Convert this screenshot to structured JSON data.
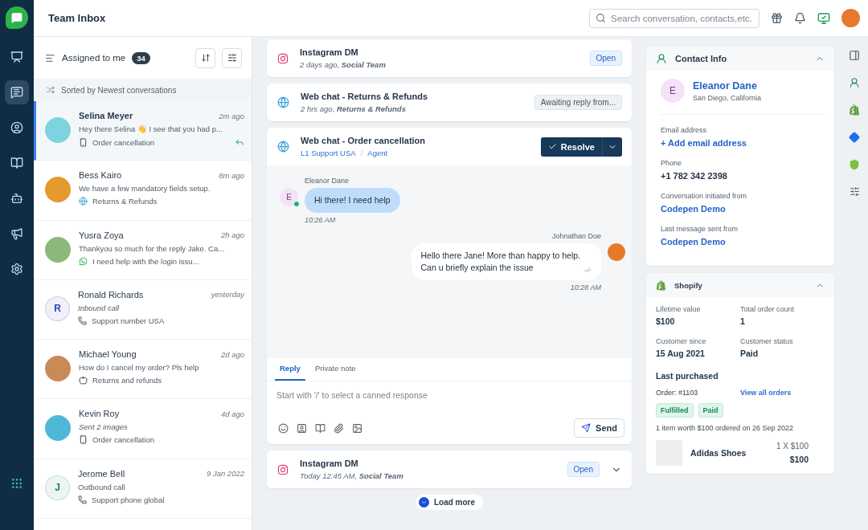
{
  "rail": {
    "nav": [
      {
        "kind": "dashboard",
        "selected": false
      },
      {
        "kind": "conversations",
        "selected": true
      },
      {
        "kind": "contacts",
        "selected": false
      },
      {
        "kind": "knowledge",
        "selected": false
      },
      {
        "kind": "bot",
        "selected": false
      },
      {
        "kind": "campaigns",
        "selected": false
      },
      {
        "kind": "settings",
        "selected": false
      }
    ]
  },
  "header": {
    "title": "Team Inbox",
    "search": {
      "placeholder": "Search conversation, contacts,etc."
    }
  },
  "inbox": {
    "filter_label": "Assigned to me",
    "count": "34",
    "sort_note": "Sorted by Newest conversations",
    "conversations": [
      {
        "name": "Selina Meyer",
        "time": "2m ago",
        "preview": "Hey there Selina 👋 I see that you had p...",
        "italic": false,
        "kind": "mobile",
        "topic": "Order cancellation",
        "avatar": {
          "kind": "photo",
          "color": "#7fd3e0"
        },
        "replied": true,
        "selected": true
      },
      {
        "name": "Bess Kairo",
        "time": "8m ago",
        "preview": "We have a few mandatory fields setup.",
        "italic": false,
        "kind": "globe",
        "topic": "Returns & Refunds",
        "avatar": {
          "kind": "photo",
          "color": "#e49a2c"
        },
        "replied": false,
        "selected": false
      },
      {
        "name": "Yusra Zoya",
        "time": "2h ago",
        "preview": "Thankyou so much for the reply Jake. Ca...",
        "italic": false,
        "kind": "whatsapp",
        "topic": "I need help with the login issu...",
        "avatar": {
          "kind": "photo",
          "color": "#8cb87a"
        },
        "replied": false,
        "selected": false
      },
      {
        "name": "Ronald Richards",
        "time": "yesterday",
        "preview": "Inbound call",
        "italic": true,
        "kind": "phone",
        "topic": "Support number USA",
        "avatar": {
          "kind": "initial",
          "initial": "R",
          "color": "#2f44b5"
        },
        "replied": false,
        "selected": false
      },
      {
        "name": "Michael Young",
        "time": "2d ago",
        "preview": "How do I cancel my order? Pls help",
        "italic": false,
        "kind": "apple",
        "topic": "Returns and refunds",
        "avatar": {
          "kind": "photo",
          "color": "#c98b55"
        },
        "replied": false,
        "selected": false
      },
      {
        "name": "Kevin Roy",
        "time": "4d ago",
        "preview": "Sent 2 images",
        "italic": true,
        "kind": "mobile",
        "topic": "Order cancellation",
        "avatar": {
          "kind": "photo",
          "color": "#4fb8d6"
        },
        "replied": false,
        "selected": false
      },
      {
        "name": "Jerome Bell",
        "time": "9 Jan 2022",
        "preview": "Outbound call",
        "italic": false,
        "kind": "phone",
        "topic": "Support phone global",
        "avatar": {
          "kind": "initial",
          "initial": "J",
          "color": "#1a7f55"
        },
        "replied": false,
        "selected": false
      }
    ]
  },
  "threads": [
    {
      "kind": "instagram",
      "title": "Instagram DM",
      "meta": "2 days ago, **Social Team**",
      "status": {
        "kind": "open",
        "label": "Open"
      }
    },
    {
      "kind": "globe",
      "title": "Web chat - Returns & Refunds",
      "meta": "2 hrs ago, **Returns & Refunds**",
      "status": {
        "kind": "awaiting",
        "label": "Awaiting reply from..."
      }
    }
  ],
  "active_thread": {
    "kind": "globe",
    "title": "Web chat - Order cancellation",
    "teams": [
      "L1 Support USA",
      "Agent"
    ],
    "team_separator": "/",
    "resolve_label": "Resolve",
    "messages": [
      {
        "kind": "contact",
        "author": "Eleanor Dane",
        "initial": "E",
        "online": true,
        "lines": [
          "Hi there! I need help"
        ],
        "time": "10:26 AM"
      },
      {
        "kind": "agent",
        "author": "Johnathan Doe",
        "lines": [
          "Hello there Jane! More than happy to help.",
          "Can u briefly explain the issue"
        ],
        "time": "10:28 AM"
      }
    ],
    "compose": {
      "tabs": [
        {
          "label": "Reply",
          "selected": true
        },
        {
          "label": "Private note",
          "selected": false
        }
      ],
      "placeholder": "Start with '/' to select a canned response",
      "send_label": "Send"
    }
  },
  "later_threads": [
    {
      "kind": "instagram",
      "title": "Instagram DM",
      "meta": "Today 12:45 AM, **Social Team**",
      "status": {
        "kind": "open",
        "label": "Open"
      }
    }
  ],
  "load_more": "Load more",
  "contact": {
    "title": "Contact Info",
    "initial": "E",
    "name": "Eleanor Dane",
    "location": "San Diego, California",
    "fields": [
      {
        "label": "Email address",
        "value": "+ Add email address",
        "kind": "link"
      },
      {
        "label": "Phone",
        "value": "+1 782 342 2398",
        "kind": "text"
      },
      {
        "label": "Conversation initiated from",
        "value": "Codepen Demo",
        "kind": "link"
      },
      {
        "label": "Last message sent from",
        "value": "Codepen Demo",
        "kind": "link"
      }
    ]
  },
  "shopify": {
    "title": "Shopify",
    "stats": [
      {
        "label": "Lifetime value",
        "value": "$100"
      },
      {
        "label": "Total order count",
        "value": "1"
      },
      {
        "label": "Customer since",
        "value": "15 Aug 2021"
      },
      {
        "label": "Customer status",
        "value": "Paid"
      }
    ],
    "last_purchased": "Last purchased",
    "order": "Order: #1103",
    "view_all": "View all orders",
    "tags": [
      "Fulfilled",
      "Paid"
    ],
    "summary": "1 item worth $100 ordered on 26 Sep 2022",
    "item": {
      "name": "Adidas Shoes",
      "qty": "1 X $100",
      "total": "$100"
    }
  }
}
